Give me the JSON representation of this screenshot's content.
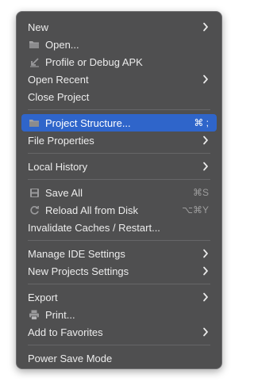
{
  "menu": {
    "groups": [
      [
        {
          "label": "New",
          "submenu": true
        },
        {
          "label": "Open...",
          "icon": "folder-icon"
        },
        {
          "label": "Profile or Debug APK",
          "icon": "import-arrow-icon"
        },
        {
          "label": "Open Recent",
          "submenu": true
        },
        {
          "label": "Close Project"
        }
      ],
      [
        {
          "label": "Project Structure...",
          "icon": "folder-icon",
          "shortcut": "⌘ ;",
          "selected": true
        },
        {
          "label": "File Properties",
          "submenu": true
        }
      ],
      [
        {
          "label": "Local History",
          "submenu": true
        }
      ],
      [
        {
          "label": "Save All",
          "icon": "save-icon",
          "shortcut": "⌘S"
        },
        {
          "label": "Reload All from Disk",
          "icon": "reload-icon",
          "shortcut": "⌥⌘Y"
        },
        {
          "label": "Invalidate Caches / Restart..."
        }
      ],
      [
        {
          "label": "Manage IDE Settings",
          "submenu": true
        },
        {
          "label": "New Projects Settings",
          "submenu": true
        }
      ],
      [
        {
          "label": "Export",
          "submenu": true
        },
        {
          "label": "Print...",
          "icon": "printer-icon"
        },
        {
          "label": "Add to Favorites",
          "submenu": true
        }
      ],
      [
        {
          "label": "Power Save Mode"
        }
      ]
    ]
  },
  "colors": {
    "menu_background": "#4f4f50",
    "selection": "#2f65ca",
    "text": "#ececec",
    "shortcut_text": "#9d9d9d",
    "separator": "#666668"
  }
}
